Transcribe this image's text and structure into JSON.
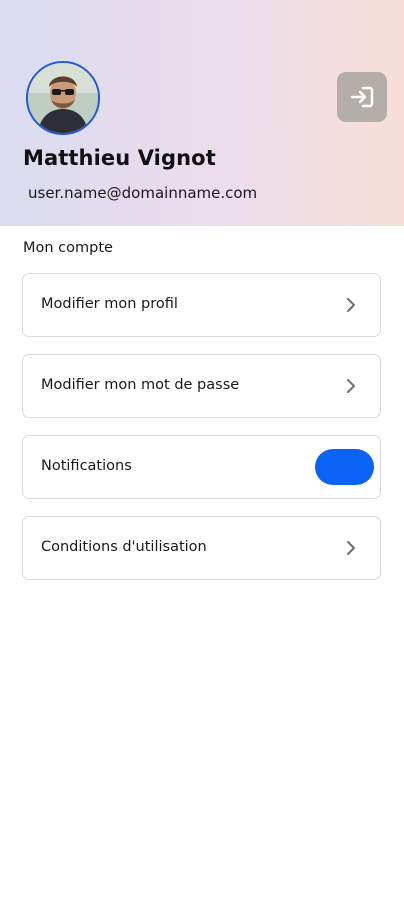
{
  "colors": {
    "accent": "#0a63f5",
    "avatar_ring": "#1f5bd8",
    "logout_bg": "#b3aeaa",
    "card_border": "#d9dbe0"
  },
  "profile": {
    "name": "Matthieu Vignot",
    "email": "user.name@domainname.com",
    "avatar_icon": "user-photo",
    "logout_icon": "logout-icon"
  },
  "section": {
    "title": "Mon compte"
  },
  "menu": [
    {
      "label": "Modifier mon profil",
      "icon": "chevron-right-icon"
    },
    {
      "label": "Modifier mon mot de passe",
      "icon": "chevron-right-icon"
    },
    {
      "label": "Notifications",
      "toggle": true
    },
    {
      "label": "Conditions d'utilisation",
      "icon": "chevron-right-icon"
    }
  ]
}
